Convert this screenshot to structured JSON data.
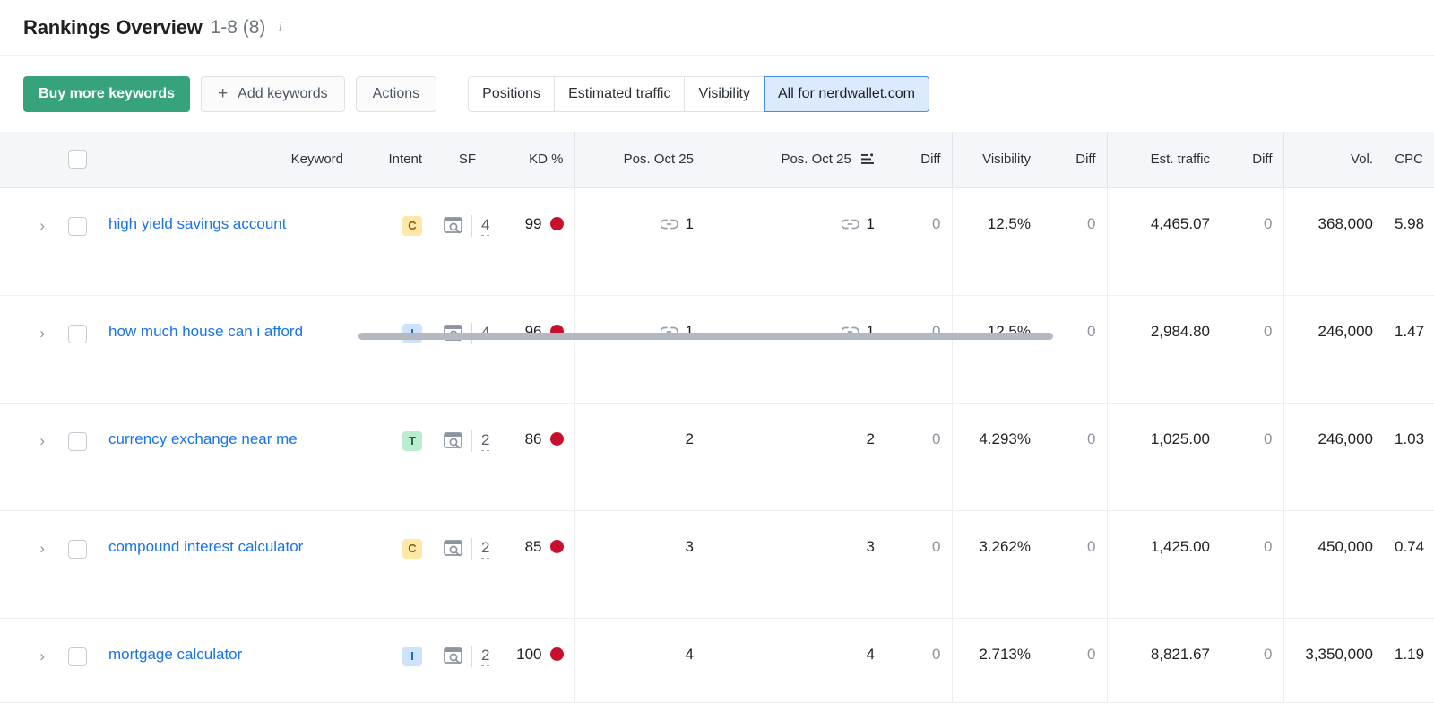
{
  "header": {
    "title": "Rankings Overview",
    "range": "1-8 (8)",
    "info_icon": "info-icon"
  },
  "toolbar": {
    "buy_label": "Buy more keywords",
    "add_label": "Add keywords",
    "add_plus": "+",
    "actions_label": "Actions",
    "segments": [
      {
        "label": "Positions",
        "active": false
      },
      {
        "label": "Estimated traffic",
        "active": false
      },
      {
        "label": "Visibility",
        "active": false
      },
      {
        "label": "All for nerdwallet.com",
        "active": true
      }
    ]
  },
  "table": {
    "columns": {
      "keyword": "Keyword",
      "intent": "Intent",
      "sf": "SF",
      "kd": "KD %",
      "pos1": "Pos. Oct 25",
      "pos2": "Pos. Oct 25",
      "diff1": "Diff",
      "visibility": "Visibility",
      "diff2": "Diff",
      "est_traffic": "Est. traffic",
      "diff3": "Diff",
      "vol": "Vol.",
      "cpc": "CPC"
    },
    "sorted_column": "Pos. Oct 25",
    "rows": [
      {
        "keyword": "high yield savings account",
        "intent": "C",
        "sf": "4",
        "kd": "99",
        "kd_color": "#c8102e",
        "pos1": "1",
        "pos1_link": true,
        "pos2": "1",
        "pos2_link": true,
        "diff1": "0",
        "visibility": "12.5%",
        "diff2": "0",
        "est_traffic": "4,465.07",
        "diff3": "0",
        "vol": "368,000",
        "cpc": "5.98"
      },
      {
        "keyword": "how much house can i afford",
        "intent": "I",
        "sf": "4",
        "kd": "96",
        "kd_color": "#c8102e",
        "pos1": "1",
        "pos1_link": true,
        "pos2": "1",
        "pos2_link": true,
        "diff1": "0",
        "visibility": "12.5%",
        "diff2": "0",
        "est_traffic": "2,984.80",
        "diff3": "0",
        "vol": "246,000",
        "cpc": "1.47"
      },
      {
        "keyword": "currency exchange near me",
        "intent": "T",
        "sf": "2",
        "kd": "86",
        "kd_color": "#c8102e",
        "pos1": "2",
        "pos1_link": false,
        "pos2": "2",
        "pos2_link": false,
        "diff1": "0",
        "visibility": "4.293%",
        "diff2": "0",
        "est_traffic": "1,025.00",
        "diff3": "0",
        "vol": "246,000",
        "cpc": "1.03"
      },
      {
        "keyword": "compound interest calculator",
        "intent": "C",
        "sf": "2",
        "kd": "85",
        "kd_color": "#c8102e",
        "pos1": "3",
        "pos1_link": false,
        "pos2": "3",
        "pos2_link": false,
        "diff1": "0",
        "visibility": "3.262%",
        "diff2": "0",
        "est_traffic": "1,425.00",
        "diff3": "0",
        "vol": "450,000",
        "cpc": "0.74"
      },
      {
        "keyword": "mortgage calculator",
        "intent": "I",
        "sf": "2",
        "kd": "100",
        "kd_color": "#c8102e",
        "pos1": "4",
        "pos1_link": false,
        "pos2": "4",
        "pos2_link": false,
        "diff1": "0",
        "visibility": "2.713%",
        "diff2": "0",
        "est_traffic": "8,821.67",
        "diff3": "0",
        "vol": "3,350,000",
        "cpc": "1.19"
      }
    ]
  },
  "colors": {
    "primary_button": "#36a37a",
    "link": "#1a73e8",
    "active_segment_bg": "#dbeafe",
    "active_segment_border": "#4a8df0",
    "kd_high": "#c8102e"
  }
}
